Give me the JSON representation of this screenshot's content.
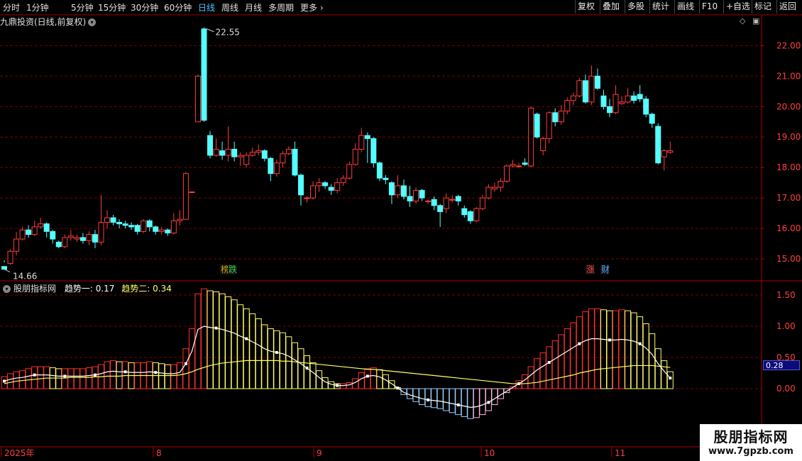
{
  "toolbar": {
    "periods": [
      "分时",
      "1分钟",
      "5分钟",
      "15分钟",
      "30分钟",
      "60分钟",
      "日线",
      "周线",
      "月线",
      "多周期",
      "更多"
    ],
    "active_period": "日线",
    "buttons": [
      "复权",
      "叠加",
      "多股",
      "统计",
      "画线",
      "F10",
      "+自选",
      "标记",
      "返回"
    ]
  },
  "stock_title": "九鼎投资(日线,前复权)",
  "indicator": {
    "name": "股朋指标网",
    "trend1_label": "趋势一:",
    "trend1_value": "0.17",
    "trend2_label": "趋势二:",
    "trend2_value": "0.34",
    "current_value": "0.28"
  },
  "price_axis": {
    "ticks": [
      "22.00",
      "21.00",
      "20.00",
      "19.00",
      "18.00",
      "17.00",
      "16.00",
      "15.00"
    ]
  },
  "indicator_axis": {
    "ticks": [
      "1.50",
      "1.00",
      "0.50",
      "0.00"
    ]
  },
  "annotations": {
    "high": "22.55",
    "low": "14.66"
  },
  "event_tags": [
    {
      "text": "榜",
      "color": "#d0a000"
    },
    {
      "text": "跌",
      "color": "#2ecc40"
    },
    {
      "text": "涨",
      "color": "#ff4040"
    },
    {
      "text": "财",
      "color": "#4fa3ff"
    }
  ],
  "date_axis": {
    "labels": [
      "2025年",
      "8",
      "9",
      "10",
      "11"
    ]
  },
  "watermark": {
    "line1": "股朋指标网",
    "line2": "www.7gpzb.com"
  },
  "colors": {
    "up": "#ff3c3c",
    "down": "#54ffff",
    "grid": "#7a0000",
    "trend1": "#ffffff",
    "trend2": "#ffff66"
  },
  "chart_data": {
    "type": "candlestick",
    "price_range": [
      14.66,
      22.55
    ],
    "candles": [
      [
        14.75,
        14.66,
        14.96,
        14.88
      ],
      [
        14.85,
        15.25,
        15.32,
        14.8
      ],
      [
        15.25,
        15.65,
        15.88,
        15.12
      ],
      [
        15.65,
        15.95,
        16.05,
        15.6
      ],
      [
        15.95,
        15.8,
        16.1,
        15.7
      ],
      [
        15.8,
        16.05,
        16.25,
        15.75
      ],
      [
        16.05,
        16.15,
        16.35,
        16.0
      ],
      [
        16.15,
        15.9,
        16.2,
        15.7
      ],
      [
        15.9,
        15.65,
        15.95,
        15.5
      ],
      [
        15.55,
        15.4,
        15.6,
        15.35
      ],
      [
        15.4,
        15.7,
        15.8,
        15.35
      ],
      [
        15.7,
        15.75,
        15.95,
        15.6
      ],
      [
        15.65,
        15.7,
        15.8,
        15.55
      ],
      [
        15.7,
        15.6,
        15.85,
        15.5
      ],
      [
        15.6,
        15.8,
        15.9,
        15.45
      ],
      [
        15.8,
        15.55,
        15.95,
        15.35
      ],
      [
        15.55,
        16.2,
        17.1,
        15.45
      ],
      [
        16.2,
        16.35,
        16.6,
        16.0
      ],
      [
        16.35,
        16.2,
        16.45,
        16.1
      ],
      [
        16.2,
        16.15,
        16.3,
        16.0
      ],
      [
        16.15,
        16.1,
        16.25,
        16.0
      ],
      [
        16.1,
        16.05,
        16.2,
        15.95
      ],
      [
        16.1,
        15.9,
        16.15,
        15.8
      ],
      [
        15.9,
        16.25,
        16.3,
        15.85
      ],
      [
        16.25,
        16.05,
        16.3,
        15.9
      ],
      [
        16.05,
        15.9,
        16.1,
        15.8
      ],
      [
        15.9,
        15.95,
        16.05,
        15.8
      ],
      [
        15.95,
        15.85,
        16.0,
        15.75
      ],
      [
        15.85,
        16.25,
        16.5,
        15.8
      ],
      [
        16.25,
        16.3,
        16.6,
        16.1
      ],
      [
        16.3,
        17.8,
        17.85,
        16.3
      ],
      [
        17.2,
        17.2,
        17.2,
        17.2
      ],
      [
        19.5,
        21.0,
        21.05,
        19.5
      ],
      [
        22.55,
        19.55,
        22.6,
        19.5
      ],
      [
        19.05,
        18.4,
        19.2,
        18.3
      ],
      [
        18.4,
        18.6,
        18.95,
        18.35
      ],
      [
        18.55,
        18.4,
        18.85,
        18.25
      ],
      [
        18.4,
        18.6,
        19.35,
        18.2
      ],
      [
        18.6,
        18.35,
        18.85,
        18.2
      ],
      [
        18.35,
        18.4,
        18.5,
        18.05
      ],
      [
        18.1,
        18.4,
        18.5,
        18.0
      ],
      [
        18.4,
        18.5,
        18.65,
        18.35
      ],
      [
        18.5,
        18.55,
        18.75,
        18.4
      ],
      [
        18.55,
        18.3,
        18.6,
        18.2
      ],
      [
        18.3,
        17.8,
        18.35,
        17.55
      ],
      [
        17.8,
        18.15,
        18.25,
        17.7
      ],
      [
        18.15,
        18.45,
        18.55,
        18.0
      ],
      [
        18.45,
        18.6,
        18.7,
        18.4
      ],
      [
        18.6,
        17.75,
        18.85,
        17.7
      ],
      [
        17.75,
        17.1,
        17.8,
        16.75
      ],
      [
        17.0,
        17.0,
        17.05,
        16.85
      ],
      [
        17.0,
        17.4,
        17.55,
        16.95
      ],
      [
        17.4,
        17.5,
        17.65,
        17.2
      ],
      [
        17.5,
        17.4,
        17.55,
        17.3
      ],
      [
        17.35,
        17.25,
        17.45,
        17.1
      ],
      [
        17.25,
        17.5,
        17.65,
        17.15
      ],
      [
        17.5,
        17.65,
        17.75,
        17.4
      ],
      [
        17.65,
        18.1,
        18.2,
        17.6
      ],
      [
        18.1,
        18.6,
        18.8,
        18.05
      ],
      [
        18.6,
        19.05,
        19.3,
        18.5
      ],
      [
        19.05,
        18.95,
        19.15,
        18.15
      ],
      [
        18.95,
        18.15,
        19.0,
        18.0
      ],
      [
        18.15,
        17.65,
        18.2,
        17.55
      ],
      [
        17.65,
        17.6,
        17.75,
        17.45
      ],
      [
        17.5,
        17.1,
        17.55,
        16.8
      ],
      [
        17.1,
        17.4,
        17.75,
        17.0
      ],
      [
        17.4,
        17.05,
        17.6,
        16.95
      ],
      [
        17.05,
        16.9,
        17.4,
        16.7
      ],
      [
        16.9,
        17.25,
        17.35,
        16.8
      ],
      [
        17.25,
        17.0,
        17.3,
        16.9
      ],
      [
        16.9,
        16.9,
        16.95,
        16.8
      ],
      [
        16.95,
        16.75,
        17.05,
        16.6
      ],
      [
        16.75,
        16.55,
        16.8,
        16.05
      ],
      [
        16.65,
        17.0,
        17.15,
        16.5
      ],
      [
        16.95,
        16.95,
        17.1,
        16.85
      ],
      [
        17.05,
        16.9,
        17.1,
        16.75
      ],
      [
        16.65,
        16.45,
        16.75,
        16.35
      ],
      [
        16.55,
        16.25,
        16.6,
        16.15
      ],
      [
        16.25,
        16.65,
        16.7,
        16.2
      ],
      [
        16.65,
        17.0,
        17.1,
        16.6
      ],
      [
        17.0,
        17.35,
        17.45,
        16.95
      ],
      [
        17.3,
        17.35,
        17.5,
        17.2
      ],
      [
        17.35,
        17.55,
        17.65,
        17.2
      ],
      [
        17.55,
        18.05,
        18.1,
        17.5
      ],
      [
        18.05,
        18.1,
        18.25,
        18.0
      ],
      [
        18.05,
        18.05,
        18.15,
        18.0
      ],
      [
        18.15,
        18.1,
        18.3,
        18.05
      ],
      [
        18.05,
        19.95,
        20.0,
        18.0
      ],
      [
        19.75,
        19.0,
        19.8,
        18.95
      ],
      [
        18.55,
        18.95,
        19.0,
        18.4
      ],
      [
        18.95,
        19.8,
        19.85,
        18.8
      ],
      [
        19.8,
        19.5,
        19.95,
        19.35
      ],
      [
        19.5,
        19.85,
        20.05,
        19.4
      ],
      [
        19.85,
        20.2,
        20.3,
        19.75
      ],
      [
        20.2,
        20.35,
        20.45,
        20.05
      ],
      [
        20.35,
        20.85,
        20.95,
        20.3
      ],
      [
        20.85,
        20.15,
        21.05,
        20.1
      ],
      [
        20.15,
        21.0,
        21.35,
        20.05
      ],
      [
        21.0,
        20.6,
        21.25,
        20.55
      ],
      [
        20.35,
        20.0,
        20.55,
        19.9
      ],
      [
        20.0,
        19.8,
        20.25,
        19.65
      ],
      [
        19.8,
        20.4,
        20.7,
        19.75
      ],
      [
        20.1,
        20.15,
        20.35,
        20.05
      ],
      [
        20.15,
        20.35,
        20.6,
        20.1
      ],
      [
        20.35,
        20.2,
        20.5,
        20.1
      ],
      [
        20.4,
        20.25,
        20.7,
        20.15
      ],
      [
        20.25,
        19.75,
        20.35,
        19.65
      ],
      [
        19.75,
        19.45,
        19.8,
        19.3
      ],
      [
        19.35,
        18.15,
        19.45,
        18.1
      ],
      [
        18.35,
        18.55,
        18.6,
        17.9
      ],
      [
        18.5,
        18.55,
        18.85,
        18.45
      ]
    ],
    "trend1": [
      0.12,
      0.15,
      0.17,
      0.18,
      0.2,
      0.22,
      0.22,
      0.22,
      0.21,
      0.2,
      0.2,
      0.2,
      0.2,
      0.2,
      0.21,
      0.22,
      0.24,
      0.27,
      0.28,
      0.27,
      0.27,
      0.26,
      0.26,
      0.26,
      0.27,
      0.26,
      0.25,
      0.24,
      0.24,
      0.26,
      0.4,
      0.6,
      0.95,
      1.0,
      0.98,
      0.97,
      0.95,
      0.92,
      0.89,
      0.84,
      0.8,
      0.75,
      0.7,
      0.64,
      0.6,
      0.58,
      0.56,
      0.52,
      0.46,
      0.4,
      0.33,
      0.26,
      0.18,
      0.11,
      0.07,
      0.05,
      0.05,
      0.06,
      0.1,
      0.16,
      0.2,
      0.21,
      0.19,
      0.14,
      0.08,
      0.01,
      -0.06,
      -0.1,
      -0.13,
      -0.16,
      -0.18,
      -0.19,
      -0.2,
      -0.22,
      -0.24,
      -0.26,
      -0.28,
      -0.3,
      -0.29,
      -0.26,
      -0.22,
      -0.16,
      -0.1,
      -0.04,
      0.02,
      0.08,
      0.14,
      0.22,
      0.3,
      0.36,
      0.42,
      0.48,
      0.54,
      0.6,
      0.66,
      0.72,
      0.77,
      0.8,
      0.8,
      0.79,
      0.78,
      0.78,
      0.79,
      0.78,
      0.76,
      0.72,
      0.65,
      0.55,
      0.4,
      0.28,
      0.17
    ],
    "trend2": [
      0.08,
      0.1,
      0.12,
      0.13,
      0.14,
      0.15,
      0.16,
      0.17,
      0.17,
      0.17,
      0.17,
      0.18,
      0.18,
      0.18,
      0.18,
      0.19,
      0.19,
      0.2,
      0.2,
      0.2,
      0.21,
      0.21,
      0.21,
      0.21,
      0.21,
      0.21,
      0.21,
      0.21,
      0.21,
      0.22,
      0.24,
      0.27,
      0.31,
      0.34,
      0.37,
      0.39,
      0.41,
      0.42,
      0.43,
      0.44,
      0.45,
      0.45,
      0.45,
      0.45,
      0.45,
      0.45,
      0.44,
      0.44,
      0.43,
      0.42,
      0.41,
      0.4,
      0.39,
      0.38,
      0.37,
      0.36,
      0.35,
      0.34,
      0.33,
      0.32,
      0.31,
      0.31,
      0.3,
      0.29,
      0.28,
      0.27,
      0.26,
      0.25,
      0.24,
      0.23,
      0.22,
      0.21,
      0.2,
      0.19,
      0.18,
      0.17,
      0.16,
      0.15,
      0.14,
      0.13,
      0.12,
      0.11,
      0.1,
      0.09,
      0.08,
      0.08,
      0.08,
      0.09,
      0.1,
      0.12,
      0.14,
      0.16,
      0.18,
      0.2,
      0.22,
      0.25,
      0.27,
      0.29,
      0.31,
      0.32,
      0.33,
      0.34,
      0.35,
      0.36,
      0.37,
      0.37,
      0.37,
      0.37,
      0.36,
      0.35,
      0.34
    ]
  }
}
